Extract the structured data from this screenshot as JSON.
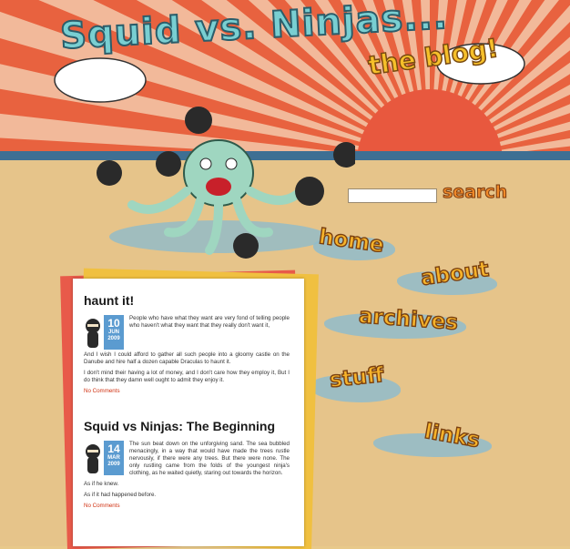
{
  "header": {
    "title": "Squid vs. Ninjas...",
    "subtitle": "the blog!"
  },
  "search": {
    "button_label": "search",
    "value": ""
  },
  "nav": [
    {
      "label": "home"
    },
    {
      "label": "about"
    },
    {
      "label": "archives"
    },
    {
      "label": "stuff"
    },
    {
      "label": "links"
    }
  ],
  "posts": [
    {
      "title": "haunt it!",
      "day": "10",
      "month": "JUN",
      "year": "2009",
      "paragraphs": [
        "People who have what they want are very fond of telling people who haven't what they want that they really don't want it,",
        "And I wish I could afford to gather all such people into a gloomy castle on the Danube and hire half a dozen capable Draculas to haunt it.",
        "I don't mind their having a lot of money, and I don't care how they employ it, But I do think that they damn well ought to admit they enjoy it."
      ],
      "comments": "No Comments"
    },
    {
      "title": "Squid vs Ninjas: The Beginning",
      "day": "14",
      "month": "MAR",
      "year": "2009",
      "paragraphs": [
        "The sun beat down on the unforgiving sand. The sea bubbled menacingly, in a way that would have made the trees rustle nervously, if there were any trees. But there were none. The only rustling came from the folds of the youngest ninja's clothing, as he waited quietly, staring out towards the horizon.",
        "As if he knew.",
        "As if it had happened before."
      ],
      "comments": "No Comments"
    }
  ]
}
